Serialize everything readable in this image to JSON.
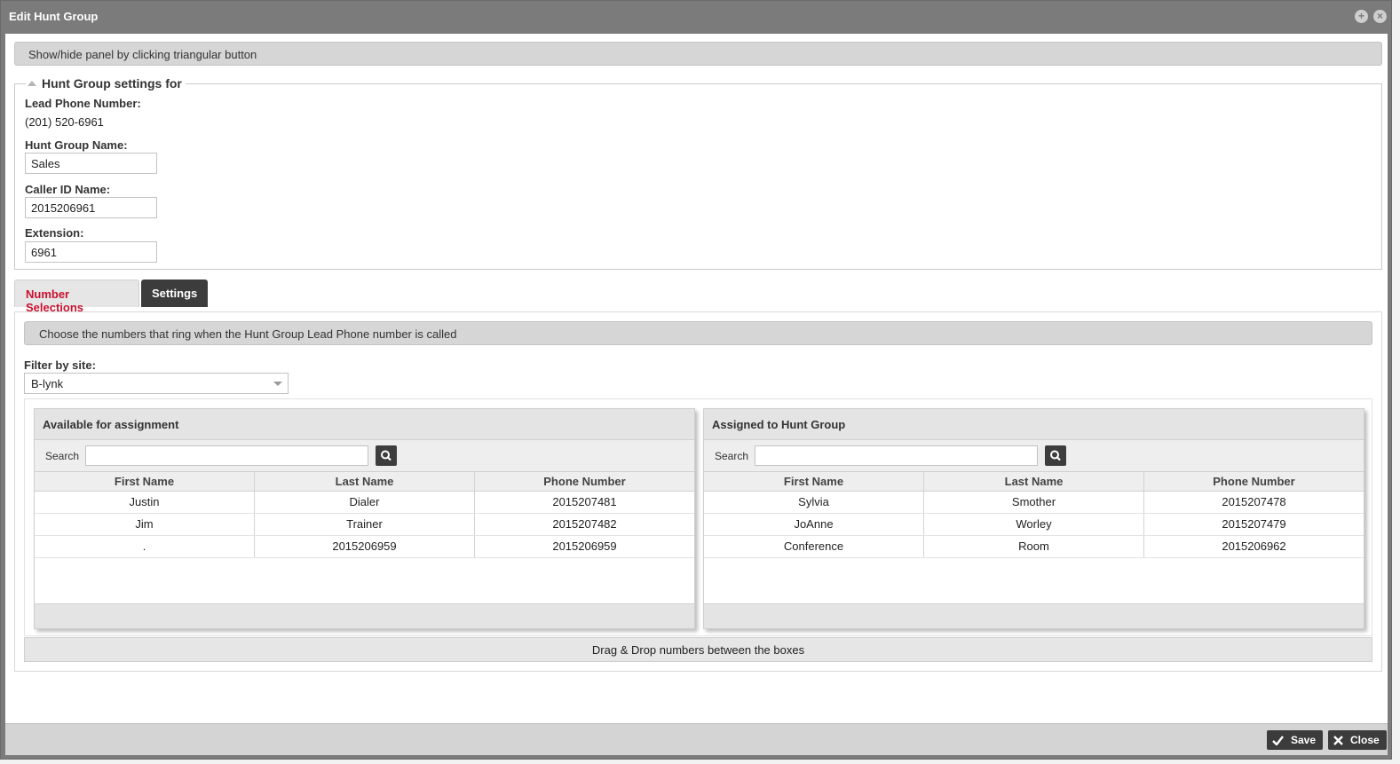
{
  "window": {
    "title": "Edit Hunt Group",
    "icons": [
      "plus-circle-icon",
      "close-circle-icon"
    ]
  },
  "hint": "Show/hide panel by clicking triangular button",
  "settings": {
    "legend": "Hunt Group settings for",
    "lead_phone_label": "Lead Phone Number:",
    "lead_phone_value": "(201) 520-6961",
    "name_label": "Hunt Group Name:",
    "name_value": "Sales",
    "caller_id_label": "Caller ID Name:",
    "caller_id_value": "2015206961",
    "extension_label": "Extension:",
    "extension_value": "6961"
  },
  "tabs": [
    {
      "label": "Number Selections",
      "active": true
    },
    {
      "label": "Settings",
      "active": false
    }
  ],
  "number_selections": {
    "hint": "Choose the numbers that ring when the Hunt Group Lead Phone number is called",
    "filter_label": "Filter by site:",
    "filter_value": "B-lynk",
    "columns": [
      "First Name",
      "Last Name",
      "Phone Number"
    ],
    "search_label": "Search",
    "available": {
      "title": "Available for assignment",
      "rows": [
        [
          "Justin",
          "Dialer",
          "2015207481"
        ],
        [
          "Jim",
          "Trainer",
          "2015207482"
        ],
        [
          ".",
          "2015206959",
          "2015206959"
        ]
      ]
    },
    "assigned": {
      "title": "Assigned to Hunt Group",
      "rows": [
        [
          "Sylvia",
          "Smother",
          "2015207478"
        ],
        [
          "JoAnne",
          "Worley",
          "2015207479"
        ],
        [
          "Conference",
          "Room",
          "2015206962"
        ]
      ]
    },
    "drag_hint": "Drag & Drop numbers between the boxes"
  },
  "footer": {
    "save_label": "Save",
    "close_label": "Close"
  },
  "colors": {
    "title_bar": "#7b7b7b",
    "active_tab_text": "#c8102e",
    "dark_button": "#3c3c3c"
  }
}
